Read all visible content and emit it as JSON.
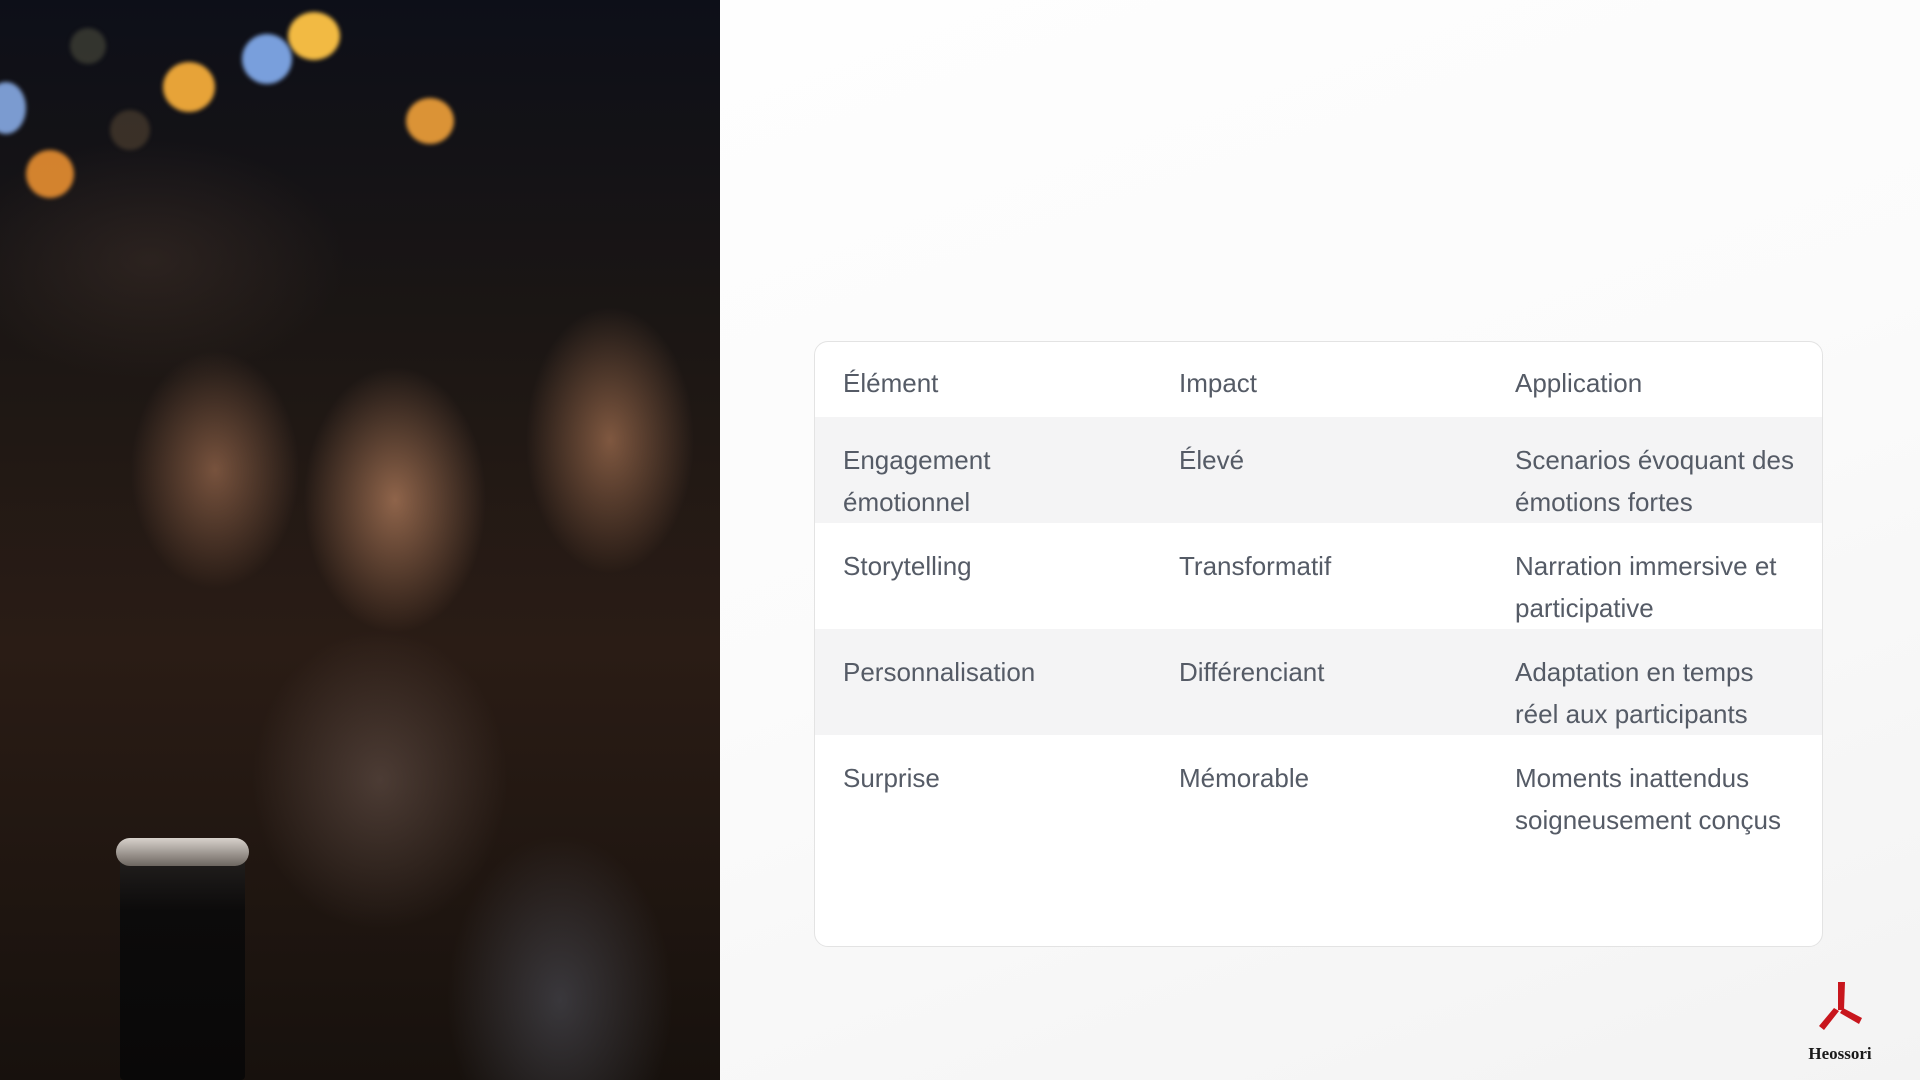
{
  "table": {
    "headers": [
      "Élément",
      "Impact",
      "Application"
    ],
    "rows": [
      [
        "Engagement émotionnel",
        "Élevé",
        "Scenarios évoquant des émotions fortes"
      ],
      [
        "Storytelling",
        "Transformatif",
        "Narration immersive et participative"
      ],
      [
        "Personnalisation",
        "Différenciant",
        "Adaptation en temps réel aux participants"
      ],
      [
        "Surprise",
        "Mémorable",
        "Moments inattendus soigneusement conçus"
      ]
    ]
  },
  "logo": {
    "name": "Heossori",
    "color": "#c8161d"
  },
  "colors": {
    "text": "#555b66",
    "row_shade": "#f4f4f5",
    "card_border": "#e3e3e3"
  }
}
